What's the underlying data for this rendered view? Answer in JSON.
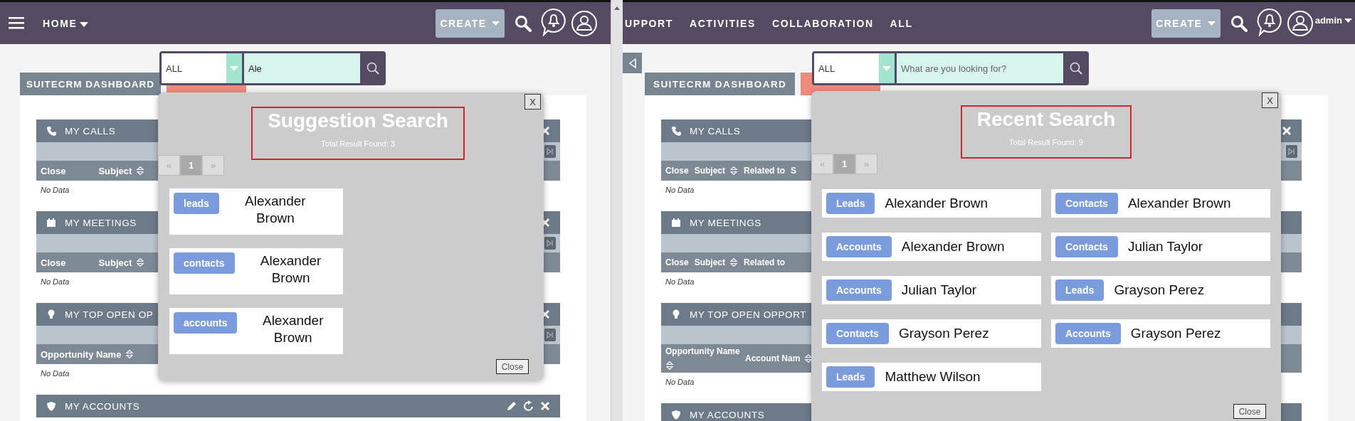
{
  "panes": [
    {
      "kind": "suggestion",
      "nav": {
        "menu_button": true,
        "items": [
          {
            "label": "HOME",
            "dropdown": true
          }
        ],
        "create": "CREATE"
      },
      "search": {
        "filter": "ALL",
        "value": "Ale"
      },
      "tabs": [
        {
          "label": "SUITECRM DASHBOARD",
          "selected": false
        },
        {
          "selected": true
        }
      ],
      "dashlets": [
        {
          "kind": "calls",
          "title": "MY CALLS",
          "close_icon": true,
          "pager": true,
          "columns": [
            {
              "label": "Close"
            },
            {
              "label": "Subject",
              "sortable": true
            }
          ],
          "empty": "No Data"
        },
        {
          "kind": "meetings",
          "title": "MY MEETINGS",
          "close_icon": true,
          "pager": true,
          "columns": [
            {
              "label": "Close"
            },
            {
              "label": "Subject",
              "sortable": true
            }
          ],
          "empty": "No Data"
        },
        {
          "kind": "opportunities",
          "title": "MY TOP OPEN OP",
          "close_icon": true,
          "pager": true,
          "columns": [
            {
              "label": "Opportunity Name",
              "sortable": true
            }
          ],
          "empty": "No Data"
        },
        {
          "kind": "accounts",
          "title": "MY ACCOUNTS",
          "edit_icon": true,
          "refresh_icon": true,
          "close_icon": true
        }
      ],
      "popup": {
        "close_x": "X",
        "title": "Suggestion Search",
        "total": "Total Result Found: 3",
        "pager": {
          "prev": "«",
          "pages": [
            {
              "label": "1",
              "selected": true
            }
          ],
          "next": "»"
        },
        "results": [
          {
            "module": "leads",
            "name": "Alexander Brown"
          },
          {
            "module": "contacts",
            "name": "Alexander Brown"
          },
          {
            "module": "accounts",
            "name": "Alexander Brown"
          }
        ],
        "close": "Close"
      }
    },
    {
      "kind": "recent",
      "nav": {
        "items": [
          {
            "label": "UPPORT",
            "dropdown": false
          },
          {
            "label": "ACTIVITIES",
            "dropdown": false
          },
          {
            "label": "COLLABORATION",
            "dropdown": false
          },
          {
            "label": "ALL",
            "dropdown": false
          }
        ],
        "create": "CREATE",
        "user_name": "admin"
      },
      "sidebar_toggle": true,
      "search": {
        "filter": "ALL",
        "placeholder": "What are you looking for?"
      },
      "tabs": [
        {
          "label": "SUITECRM DASHBOARD",
          "selected": false
        },
        {
          "selected": true
        }
      ],
      "dashlets": [
        {
          "kind": "calls",
          "title": "MY CALLS",
          "close_icon": true,
          "pager": true,
          "columns": [
            {
              "label": "Close"
            },
            {
              "label": "Subject",
              "sortable": true
            },
            {
              "label": "Related to"
            },
            {
              "label": "S"
            }
          ],
          "empty": "No Data"
        },
        {
          "kind": "meetings",
          "title": "MY MEETINGS",
          "columns": [
            {
              "label": "Close"
            },
            {
              "label": "Subject",
              "sortable": true
            },
            {
              "label": "Related to"
            }
          ],
          "empty": "No Data"
        },
        {
          "kind": "opportunities",
          "title": "MY TOP OPEN OPPORT",
          "columns": [
            {
              "label": "Opportunity Name",
              "sortable": true
            },
            {
              "label": "Account Nam",
              "sortable": true
            }
          ],
          "empty": "No Data"
        },
        {
          "kind": "accounts",
          "title": "MY ACCOUNTS"
        }
      ],
      "popup": {
        "close_x": "X",
        "title": "Recent Search",
        "total": "Total Result Found: 9",
        "pager": {
          "prev": "«",
          "pages": [
            {
              "label": "1",
              "selected": true
            }
          ],
          "next": "»"
        },
        "results": [
          {
            "module": "Leads",
            "name": "Alexander Brown"
          },
          {
            "module": "Contacts",
            "name": "Alexander Brown"
          },
          {
            "module": "Accounts",
            "name": "Alexander Brown"
          },
          {
            "module": "Contacts",
            "name": "Julian Taylor"
          },
          {
            "module": "Accounts",
            "name": "Julian Taylor"
          },
          {
            "module": "Leads",
            "name": "Grayson Perez"
          },
          {
            "module": "Contacts",
            "name": "Grayson Perez"
          },
          {
            "module": "Accounts",
            "name": "Grayson Perez"
          },
          {
            "module": "Leads",
            "name": "Matthew Wilson"
          }
        ],
        "close": "Close"
      }
    }
  ]
}
